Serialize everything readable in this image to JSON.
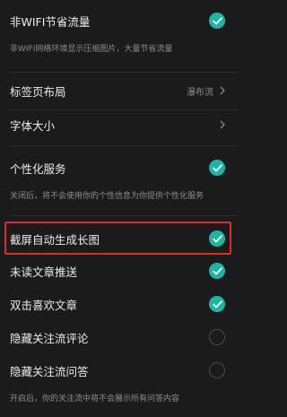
{
  "settings": {
    "wifi_saving": {
      "label": "非WIFI节省流量",
      "desc": "非WIFI网络环境显示压缩图片，大量节省流量",
      "checked": true
    },
    "tab_layout": {
      "label": "标签页布局",
      "value": "瀑布流"
    },
    "font_size": {
      "label": "字体大小"
    },
    "personalized": {
      "label": "个性化服务",
      "desc": "关闭后，将不会使用你的个性信息为你提供个性化服务",
      "checked": true
    },
    "screenshot_image": {
      "label": "截屏自动生成长图",
      "checked": true
    },
    "unread_push": {
      "label": "未读文章推送",
      "checked": true
    },
    "double_tap_like": {
      "label": "双击喜欢文章",
      "checked": true
    },
    "hide_feed_comments": {
      "label": "隐藏关注流评论",
      "checked": false
    },
    "hide_feed_qa": {
      "label": "隐藏关注流问答",
      "desc": "开启后，你的关注流中将不会展示所有问答内容",
      "checked": false
    }
  },
  "colors": {
    "background": "#1b1b1b",
    "accent": "#1fb5a6",
    "highlight": "#d72f2f"
  }
}
